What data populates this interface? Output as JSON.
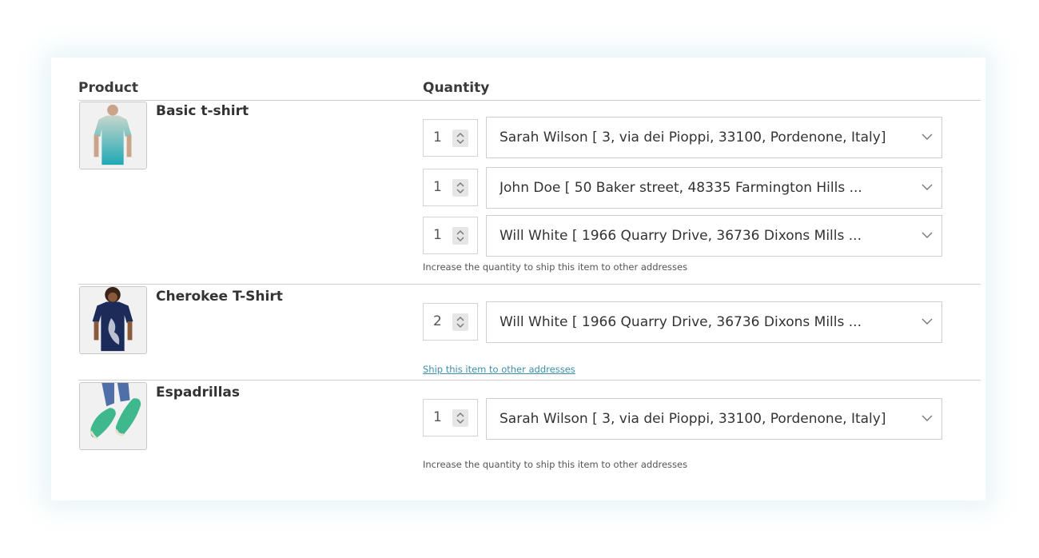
{
  "header": {
    "product": "Product",
    "quantity": "Quantity"
  },
  "products": [
    {
      "name": "Basic t-shirt",
      "lines": [
        {
          "qty": "1",
          "address": "Sarah Wilson [ 3, via dei Pioppi, 33100, Pordenone, Italy]"
        },
        {
          "qty": "1",
          "address": "John Doe [ 50 Baker street, 48335 Farmington Hills ..."
        },
        {
          "qty": "1",
          "address": "Will White [ 1966 Quarry Drive, 36736 Dixons Mills ..."
        }
      ],
      "hint": "Increase the quantity to ship this item to other addresses"
    },
    {
      "name": "Cherokee T-Shirt",
      "lines": [
        {
          "qty": "2",
          "address": "Will White [ 1966 Quarry Drive, 36736 Dixons Mills ..."
        }
      ],
      "link": "Ship this item to other addresses"
    },
    {
      "name": "Espadrillas",
      "lines": [
        {
          "qty": "1",
          "address": "Sarah Wilson [ 3, via dei Pioppi, 33100, Pordenone, Italy]"
        }
      ],
      "hint": "Increase the quantity to ship this item to other addresses"
    }
  ],
  "colors": {
    "link": "#3d8fa8",
    "tshirt_top": "#b9cfc4",
    "tshirt_bottom": "#1fa9b5",
    "navy_shirt": "#1d2b5a",
    "espadrille": "#3fb88e"
  }
}
